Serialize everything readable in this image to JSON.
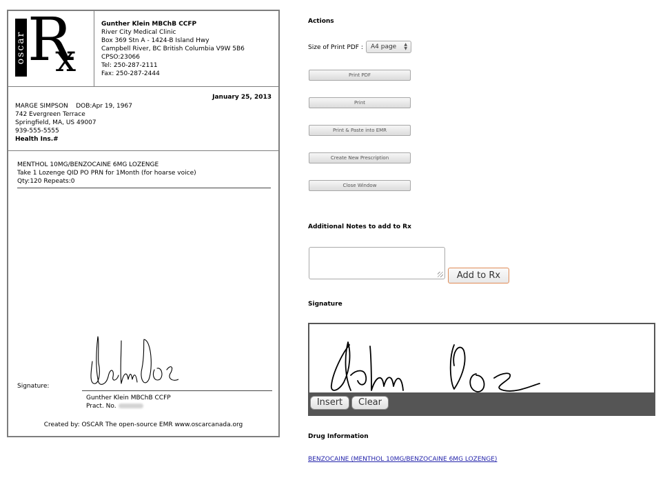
{
  "rx": {
    "logo": {
      "oscar": "oscar",
      "r": "R",
      "x": "x"
    },
    "clinic": {
      "doctor": "Gunther Klein MBChB CCFP",
      "name": "River City Medical Clinic",
      "address1": "Box 369 Stn A - 1424-B Island Hwy",
      "address2": "Campbell River, BC  British Columbia   V9W 5B6",
      "cpso": "CPSO:23066",
      "tel": "Tel: 250-287-2111",
      "fax": "Fax: 250-287-2444"
    },
    "date": "January 25, 2013",
    "patient": {
      "name_dob": "MARGE SIMPSON    DOB:Apr 19, 1967",
      "address1": "742 Evergreen Terrace",
      "address2": "Springfield, MA, US 49007",
      "phone": "939-555-5555",
      "health_ins": "Health Ins.#"
    },
    "drug": {
      "name": "MENTHOL 10MG/BENZOCAINE 6MG LOZENGE",
      "instructions": "Take 1 Lozenge QID PO PRN for 1Month (for hoarse voice)",
      "qty": "Qty:120 Repeats:0"
    },
    "signature_label": "Signature:",
    "prescriber": "Gunther Klein MBChB CCFP",
    "pract_no": "Pract. No.",
    "footer": "Created by: OSCAR The open-source EMR www.oscarcanada.org"
  },
  "panel": {
    "actions_header": "Actions",
    "size_label": "Size of Print PDF :",
    "size_value": "A4 page",
    "buttons": {
      "print_pdf": "Print PDF",
      "print": "Print",
      "print_paste": "Print & Paste into EMR",
      "create_new": "Create New Prescription",
      "close": "Close Window"
    },
    "notes_header": "Additional Notes to add to Rx",
    "add_to_rx": "Add to Rx",
    "signature_header": "Signature",
    "insert": "Insert",
    "clear": "Clear",
    "drug_info_header": "Drug Information",
    "drug_link": "BENZOCAINE (MENTHOL 10MG/BENZOCAINE 6MG LOZENGE)"
  },
  "icons": {
    "select_arrows": "up-down-arrows-icon",
    "resize_grip": "resize-grip-icon"
  },
  "colors": {
    "border": "#7d7d7d",
    "add_button_border": "#e08a55",
    "signature_bar": "#555555",
    "link": "#2222aa"
  }
}
